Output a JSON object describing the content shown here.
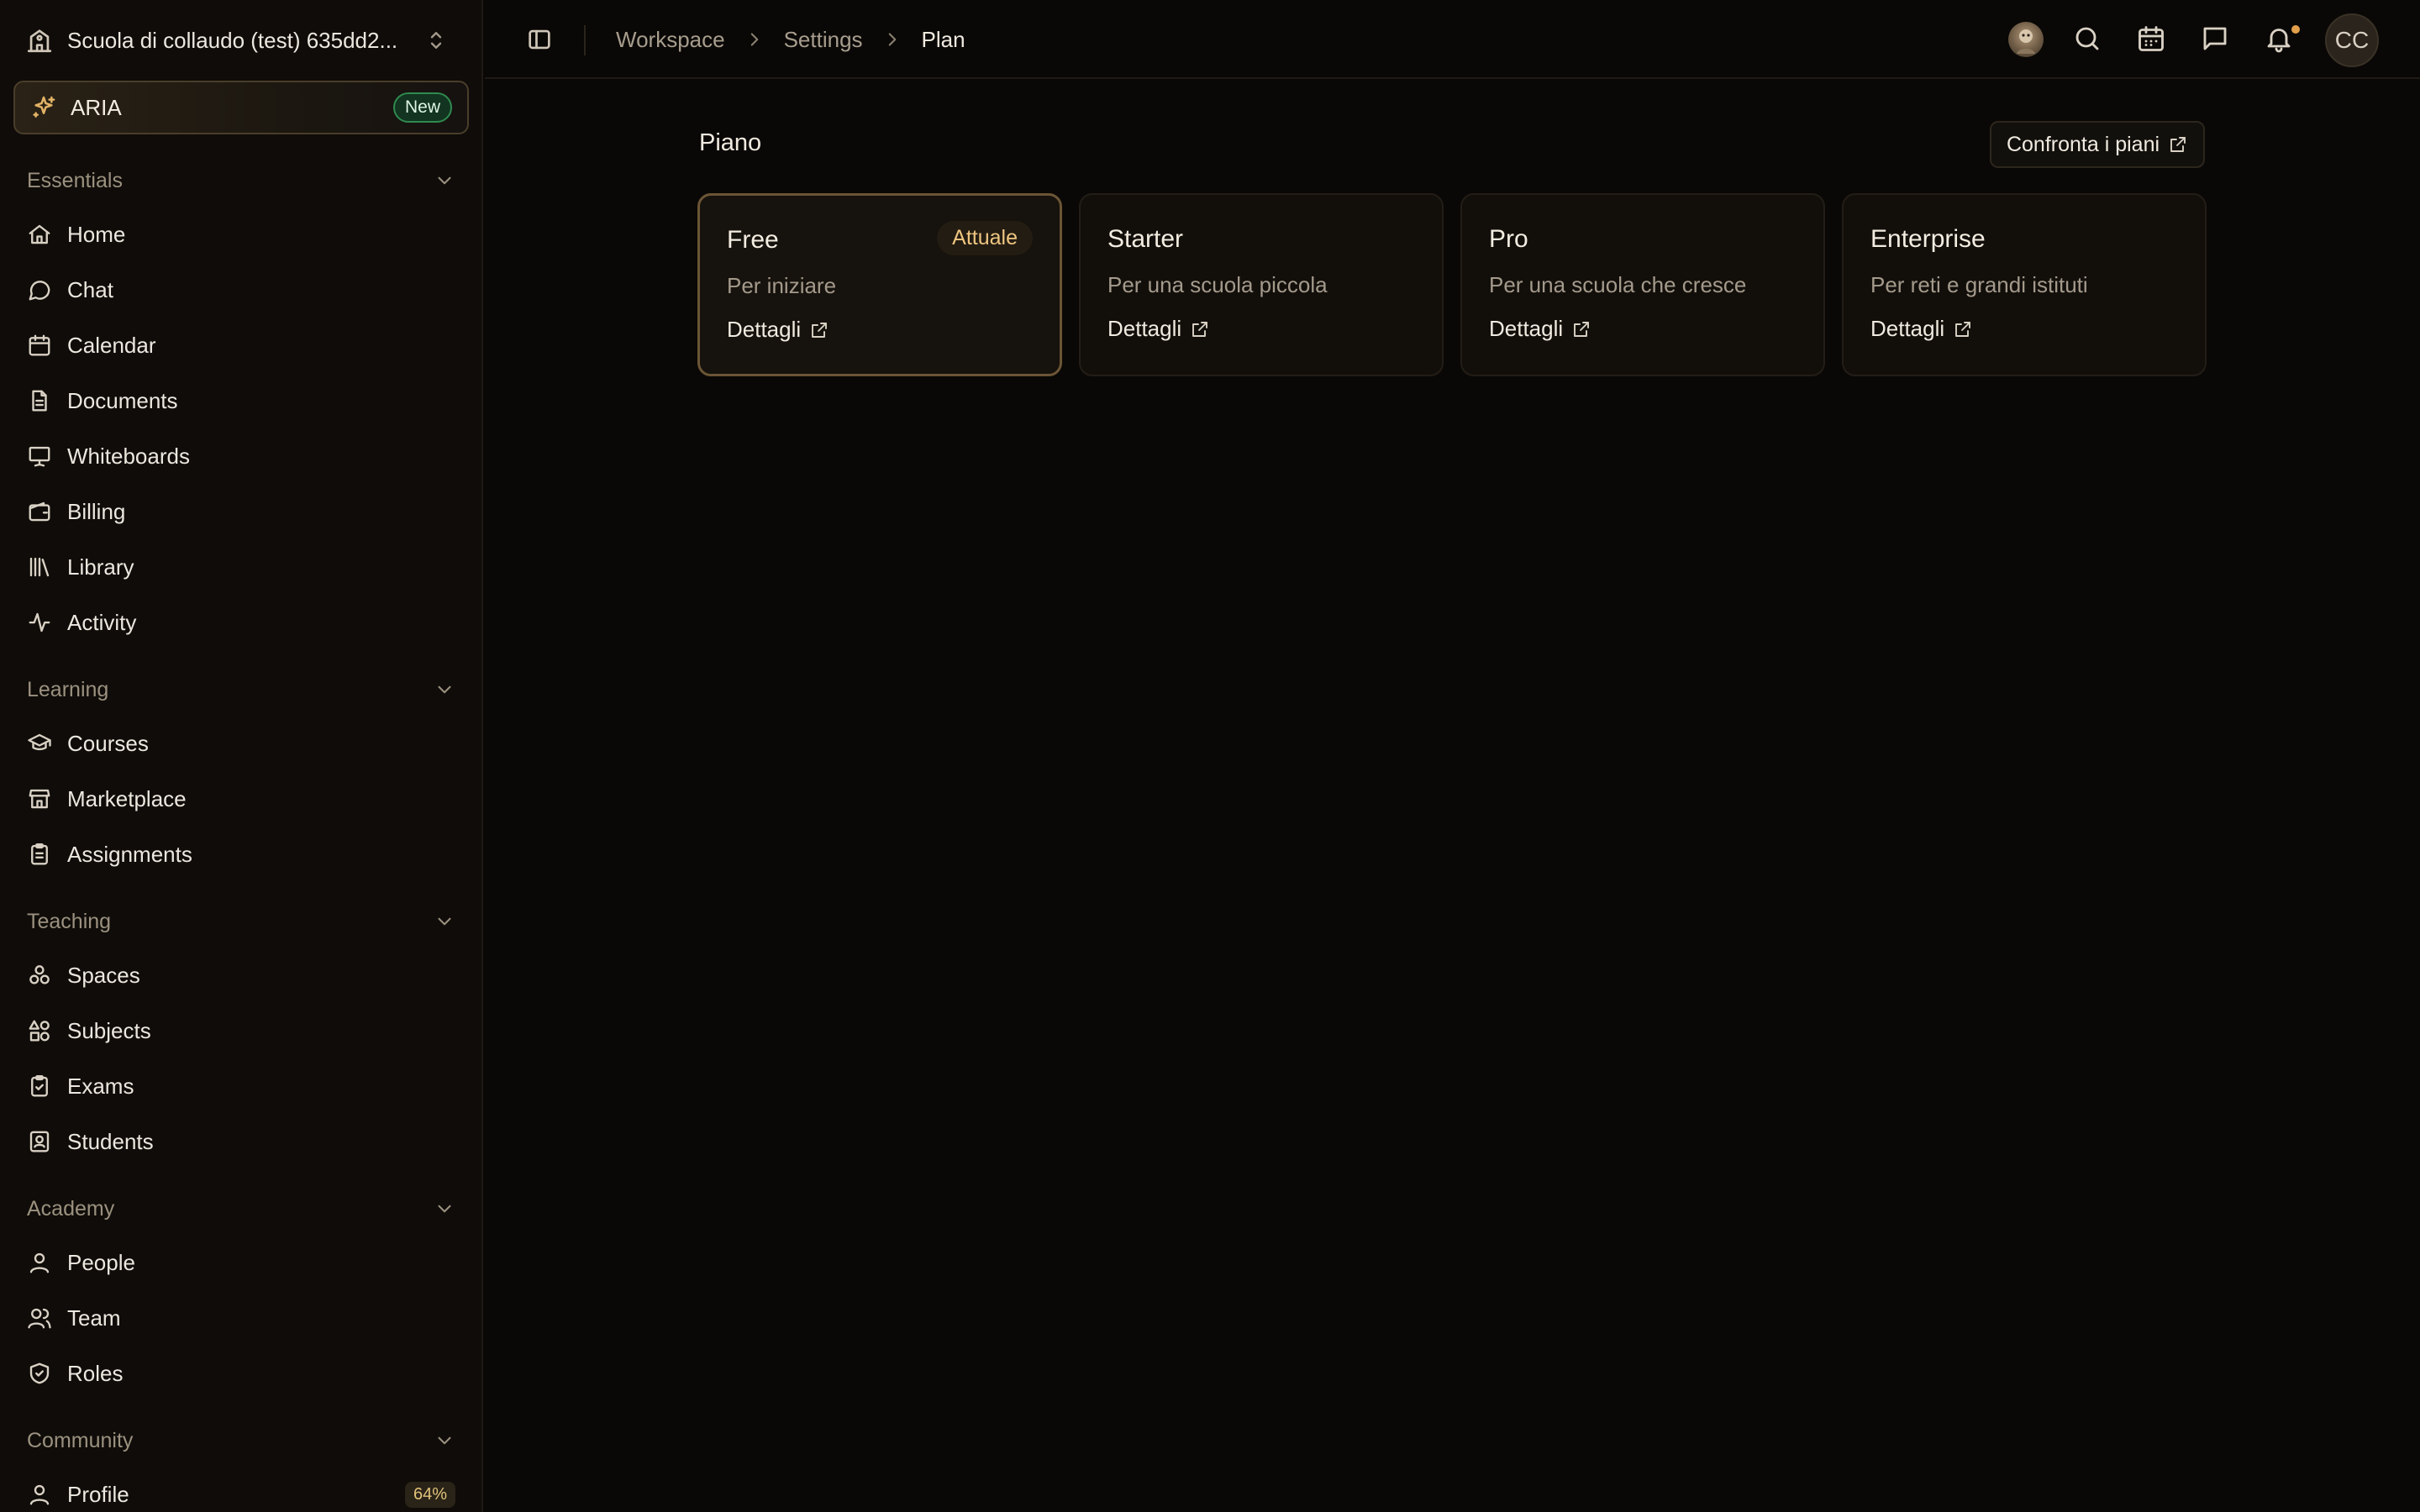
{
  "workspace": {
    "name": "Scuola di collaudo (test) 635dd2..."
  },
  "aria": {
    "label": "ARIA",
    "badge": "New"
  },
  "sidebar": {
    "sections": [
      {
        "title": "Essentials",
        "items": [
          "Home",
          "Chat",
          "Calendar",
          "Documents",
          "Whiteboards",
          "Billing",
          "Library",
          "Activity"
        ]
      },
      {
        "title": "Learning",
        "items": [
          "Courses",
          "Marketplace",
          "Assignments"
        ]
      },
      {
        "title": "Teaching",
        "items": [
          "Spaces",
          "Subjects",
          "Exams",
          "Students"
        ]
      },
      {
        "title": "Academy",
        "items": [
          "People",
          "Team",
          "Roles"
        ]
      },
      {
        "title": "Community",
        "items": [
          "Profile"
        ]
      }
    ],
    "profile_progress": "64%"
  },
  "breadcrumb": [
    "Workspace",
    "Settings",
    "Plan"
  ],
  "user": {
    "initials": "CC"
  },
  "main": {
    "title": "Piano",
    "compare_button": "Confronta i piani",
    "plans": [
      {
        "name": "Free",
        "description": "Per iniziare",
        "link": "Dettagli",
        "badge": "Attuale"
      },
      {
        "name": "Starter",
        "description": "Per una scuola piccola",
        "link": "Dettagli"
      },
      {
        "name": "Pro",
        "description": "Per una scuola che cresce",
        "link": "Dettagli"
      },
      {
        "name": "Enterprise",
        "description": "Per reti e grandi istituti",
        "link": "Dettagli"
      }
    ]
  },
  "colors": {
    "background": "#0a0806",
    "accent": "#e3b366",
    "current_badge": "#efc681",
    "new_badge": "#2f8a4f"
  }
}
